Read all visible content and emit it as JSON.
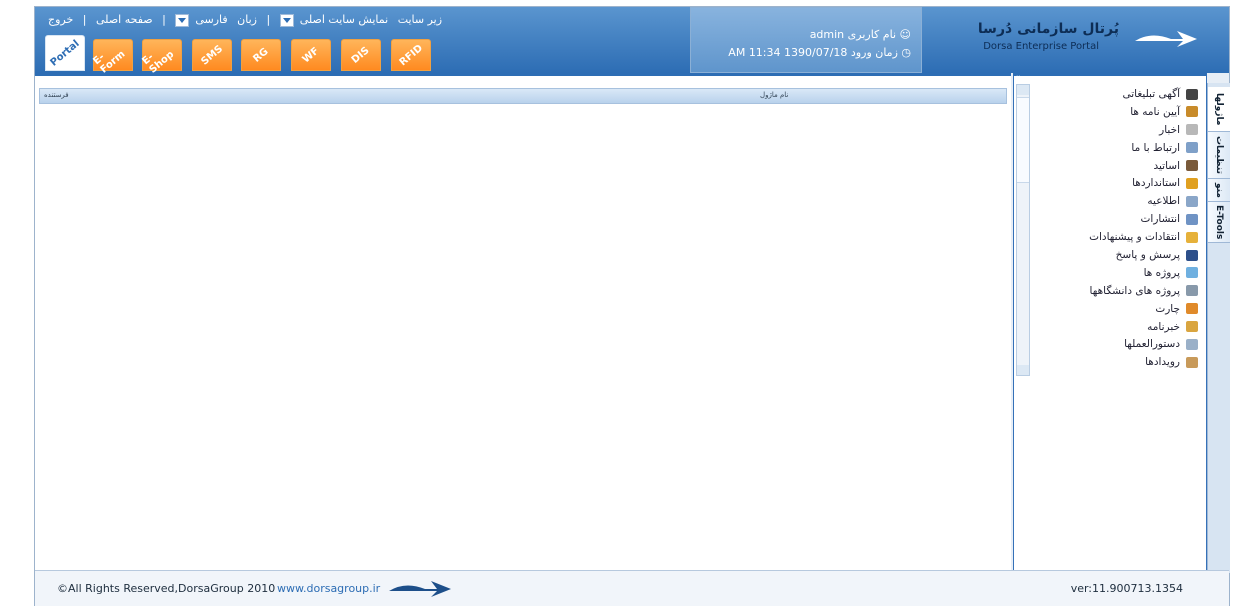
{
  "header": {
    "logo_title": "پُرتال سازمانی دُرسا",
    "logo_sub": "Dorsa Enterprise Portal",
    "user_label": "نام کاربری",
    "user_value": "admin",
    "login_label": "زمان ورود",
    "login_value": "1390/07/18  11:34 AM",
    "nav": {
      "subsite": "زیر سایت",
      "view_main": "نمایش سایت اصلی",
      "language": "زبان",
      "lang_value": "فارسی",
      "home": "صفحه اصلی",
      "logout": "خروج",
      "sep": "|"
    }
  },
  "tabs": [
    "Portal",
    "E-Form",
    "E-Shop",
    "SMS",
    "RG",
    "WF",
    "DIS",
    "RFID"
  ],
  "grid": {
    "col_from": "فرستنده",
    "col_subject": "نام ماژول"
  },
  "sidebar": {
    "collapse": "»",
    "items": [
      {
        "label": "آگهی تبلیغاتی",
        "icon": "monitor-icon",
        "color": "#444444"
      },
      {
        "label": "آیین نامه ها",
        "icon": "book-icon",
        "color": "#c88b2a"
      },
      {
        "label": "اخبار",
        "icon": "newspaper-icon",
        "color": "#b8b8b8"
      },
      {
        "label": "ارتباط با ما",
        "icon": "mail-icon",
        "color": "#7fa0c8"
      },
      {
        "label": "اساتید",
        "icon": "teacher-icon",
        "color": "#7a5a3a"
      },
      {
        "label": "استانداردها",
        "icon": "badge-icon",
        "color": "#e0a020"
      },
      {
        "label": "اطلاعیه",
        "icon": "notice-icon",
        "color": "#8aa6c8"
      },
      {
        "label": "انتشارات",
        "icon": "publication-icon",
        "color": "#6f93c4"
      },
      {
        "label": "انتقادات و پیشنهادات",
        "icon": "feedback-icon",
        "color": "#e6b13a"
      },
      {
        "label": "پرسش و پاسخ",
        "icon": "question-icon",
        "color": "#2d4f8a"
      },
      {
        "label": "پروژه ها",
        "icon": "project-icon",
        "color": "#6fb0e0"
      },
      {
        "label": "پروژه های دانشگاهها",
        "icon": "university-project-icon",
        "color": "#8899aa"
      },
      {
        "label": "چارت",
        "icon": "chart-icon",
        "color": "#e08a2a"
      },
      {
        "label": "خبرنامه",
        "icon": "newsletter-icon",
        "color": "#d9a540"
      },
      {
        "label": "دستورالعملها",
        "icon": "instructions-icon",
        "color": "#9ab0c8"
      },
      {
        "label": "رویدادها",
        "icon": "events-icon",
        "color": "#c89a5a"
      }
    ]
  },
  "vtabs": [
    "ماژولها",
    "تنظیمات",
    "منو",
    "E-Tools"
  ],
  "footer": {
    "copyright": "©All Rights Reserved,DorsaGroup 2010",
    "website": "www.dorsagroup.ir",
    "version": "ver:11.900713.1354"
  }
}
